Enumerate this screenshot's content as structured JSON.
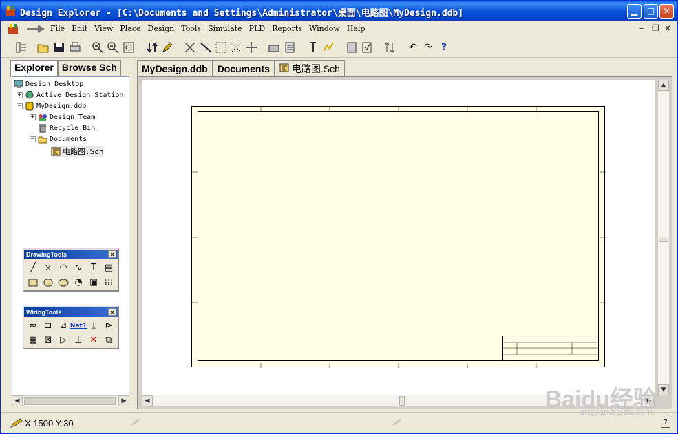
{
  "window": {
    "title": "Design Explorer - [C:\\Documents and Settings\\Administrator\\桌面\\电路图\\MyDesign.ddb]"
  },
  "menu": {
    "items": [
      "File",
      "Edit",
      "View",
      "Place",
      "Design",
      "Tools",
      "Simulate",
      "PLD",
      "Reports",
      "Window",
      "Help"
    ]
  },
  "left_panel": {
    "tabs": [
      "Explorer",
      "Browse Sch"
    ],
    "tree": [
      {
        "label": "Design Desktop",
        "icon": "desktop-icon"
      },
      {
        "label": "Active Design Station",
        "icon": "station-icon"
      },
      {
        "label": "MyDesign.ddb",
        "icon": "database-icon"
      },
      {
        "label": "Design Team",
        "icon": "team-icon"
      },
      {
        "label": "Recycle Bin",
        "icon": "recycle-bin-icon"
      },
      {
        "label": "Documents",
        "icon": "folder-icon"
      },
      {
        "label": "电路图.Sch",
        "icon": "schematic-icon"
      }
    ]
  },
  "palettes": {
    "drawing": {
      "title": "DrawingTools",
      "close": "×"
    },
    "wiring": {
      "title": "WiringTools",
      "close": "×",
      "net_label": "Net1"
    }
  },
  "doc_tabs": [
    "MyDesign.ddb",
    "Documents",
    "电路图.Sch"
  ],
  "status": {
    "coords": "X:1500 Y:30"
  },
  "watermark": {
    "brand": "Baidu经验",
    "url": "jingyan.baidu.com"
  },
  "colors": {
    "titlebar": "#0b53d8",
    "sheet": "#ffffe6",
    "palette_title": "#0a3c9c"
  }
}
